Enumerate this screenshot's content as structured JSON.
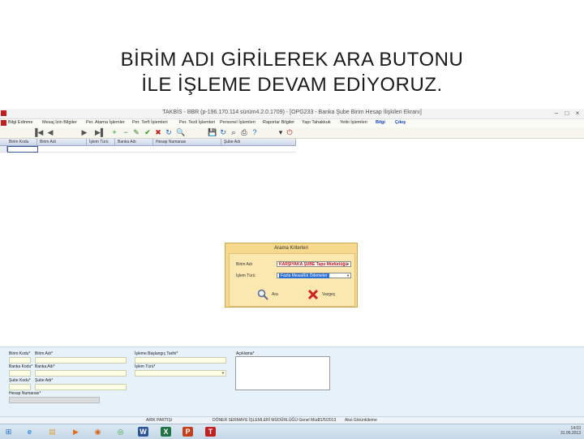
{
  "slide": {
    "title_line1": "BİRİM ADI GİRİLEREK ARA BUTONU",
    "title_line2": "İLE İŞLEME DEVAM EDİYORUZ."
  },
  "window": {
    "title": "TAKBİS - BBR (p-196.170.114 sürüm4.2.0.1709) - [OPG233 - Banka Şube Birim Hesap İlişkileri Ekranı]",
    "min_glyph": "–",
    "max_glyph": "□",
    "close_glyph": "×"
  },
  "menu": [
    {
      "label": "Bilgi Edinme",
      "blue": false
    },
    {
      "label": "Mesaj İzin Bilgiler",
      "blue": false
    },
    {
      "label": "Per. Atama İşlemler",
      "blue": false
    },
    {
      "label": "Per. Terfi İşlemleri",
      "blue": false
    },
    {
      "label": "Per. Tezil İşlemleri",
      "blue": false
    },
    {
      "label": "Personel İşlemleri",
      "blue": false
    },
    {
      "label": "Raporlar Bilgiler",
      "blue": false
    },
    {
      "label": "Yapı Tahakkuk",
      "blue": false
    },
    {
      "label": "Yetki İşlemleri",
      "blue": false
    },
    {
      "label": "Bilgi",
      "blue": true
    },
    {
      "label": "Çıkış",
      "blue": true
    }
  ],
  "toolbar": {
    "icons": [
      "first-record-icon",
      "previous-record-icon",
      "next-record-icon",
      "last-record-icon",
      "add-icon",
      "remove-icon",
      "edit-icon",
      "check-icon",
      "cancel-icon",
      "refresh-icon",
      "search-icon",
      "save-icon",
      "refresh-alt-icon",
      "lookup-icon",
      "print-icon",
      "help-icon",
      "options-icon",
      "exit-icon"
    ],
    "glyphs": [
      "▐◀",
      "◀",
      "▶",
      "▶▌",
      "+",
      "−",
      "✎",
      "✔",
      "✖",
      "↻",
      "🔍",
      "💾",
      "↻",
      "⌕",
      "⎙",
      "?",
      "▾",
      "⏻"
    ],
    "colors": [
      "#555555",
      "#555555",
      "#555555",
      "#555555",
      "#1a9a1a",
      "#1a9a1a",
      "#2a7a2a",
      "#1a9a1a",
      "#c02020",
      "#2060c0",
      "#333333",
      "#2050a0",
      "#2060c0",
      "#333333",
      "#333333",
      "#2060c0",
      "#333333",
      "#c02020"
    ]
  },
  "grid": {
    "columns": [
      "Birim Kodu",
      "Birim Adı",
      "İşlem Türü",
      "Banka Adı",
      "Hesap Numarası",
      "Şube Adı"
    ]
  },
  "dialog": {
    "title": "Arama Kriterleri",
    "birim_label": "Birim Adı",
    "birim_value": "KARŞIYAKA ŞUBE Tapu Müdürlüğü",
    "islem_label": "İşlem Türü",
    "islem_value": "Fazla Mesai/Ek Ödemeler",
    "ara_label": "Ara",
    "vazgec_label": "Vazgeç"
  },
  "form": {
    "birim_kodu": "Birim Kodu*",
    "birim_adi": "Birim Adı*",
    "banka_kodu": "Banka Kodu*",
    "banka_adi": "Banka Adı*",
    "sube_kodu": "Şube Kodu*",
    "sube_adi": "Şube Adı*",
    "hesap_numarasi": "Hesap Numarası*",
    "islem_tarihi": "İşleme Başlangıç Tarihi*",
    "islem_turu": "İşlem Türü*",
    "aciklama": "Açıklama*"
  },
  "status": {
    "left": "ARIK PARTIŞI",
    "middle": "DÖNER SERMAYE İŞLEMLERİ MÜDÜRLÜĞÜ Genel Müd.",
    "date": "31/5/2013",
    "right": "Aksi Görüntüleme"
  },
  "taskbar": {
    "apps": [
      "windows-start-icon",
      "internet-explorer-icon",
      "file-explorer-icon",
      "media-player-icon",
      "firefox-icon",
      "chrome-icon",
      "word-icon",
      "excel-icon",
      "powerpoint-icon",
      "takbis-app-icon"
    ],
    "glyphs": [
      "⊞",
      "e",
      "▤",
      "▶",
      "◉",
      "◎",
      "W",
      "X",
      "P",
      "T"
    ],
    "colors": [
      "#1e6fc0",
      "#2a8ae0",
      "#e0a030",
      "#e07020",
      "#e0601a",
      "#3aa040",
      "#2b579a",
      "#217346",
      "#c43e1c",
      "#c02020"
    ],
    "clock": "14:03",
    "date": "31.05.2013"
  }
}
